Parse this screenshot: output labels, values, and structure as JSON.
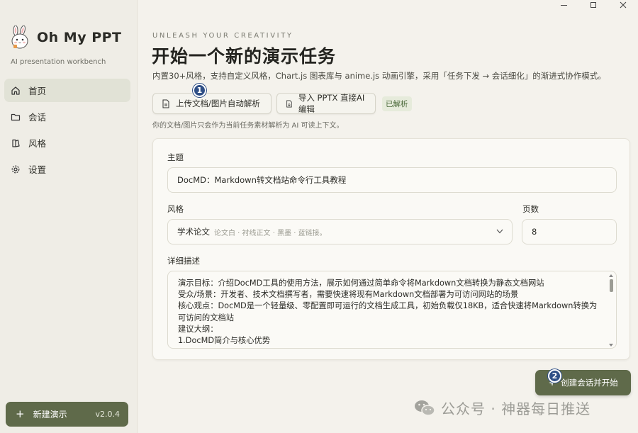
{
  "app": {
    "name": "Oh My PPT",
    "subtitle": "AI presentation workbench",
    "version": "v2.0.4"
  },
  "sidebar": {
    "items": [
      {
        "label": "首页",
        "icon": "home-icon",
        "active": true
      },
      {
        "label": "会话",
        "icon": "folder-icon",
        "active": false
      },
      {
        "label": "风格",
        "icon": "palette-icon",
        "active": false
      },
      {
        "label": "设置",
        "icon": "gear-icon",
        "active": false
      }
    ],
    "new_label": "新建演示"
  },
  "header": {
    "tagline": "UNLEASH YOUR CREATIVITY",
    "title": "开始一个新的演示任务",
    "description": "内置30+风格，支持自定义风格，Chart.js 图表库与 anime.js 动画引擎，采用「任务下发 → 会话细化」的渐进式协作模式。"
  },
  "actions": {
    "upload_label": "上传文档/图片自动解析",
    "import_label": "导入 PPTX 直接AI编辑",
    "parsed_label": "已解析",
    "hint": "你的文档/图片只会作为当前任务素材解析为 AI 可读上下文。",
    "badge1": "1",
    "badge2": "2"
  },
  "form": {
    "topic_label": "主题",
    "topic_value": "DocMD：Markdown转文档站命令行工具教程",
    "style_label": "风格",
    "style_value": "学术论文",
    "style_sub": "论文白 · 衬线正文 · 黑墨 · 蓝链接。",
    "pages_label": "页数",
    "pages_value": "8",
    "detail_label": "详细描述",
    "detail_value": "演示目标：介绍DocMD工具的使用方法，展示如何通过简单命令将Markdown文档转换为静态文档网站\n受众/场景：开发者、技术文档撰写者，需要快速将现有Markdown文档部署为可访问网站的场景\n核心观点：DocMD是一个轻量级、零配置即可运行的文档生成工具，初始负载仅18KB，适合快速将Markdown转换为可访问的文档站\n建议大纲：\n1.DocMD简介与核心优势"
  },
  "submit": {
    "label": "创建会话并开始"
  },
  "watermark": {
    "text": "公众号 · 神器每日推送"
  },
  "colors": {
    "accent": "#5f6a4a",
    "background": "#f4f2ec",
    "badge": "#2f4f86"
  }
}
